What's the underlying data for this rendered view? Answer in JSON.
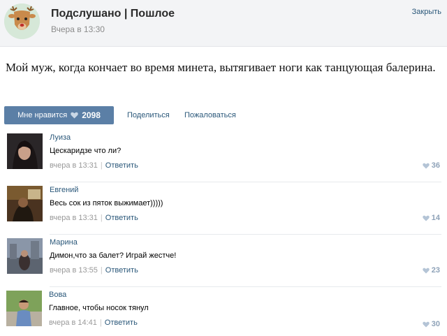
{
  "header": {
    "group_name": "Подслушано | Пошлое",
    "time": "Вчера в 13:30",
    "close_label": "Закрыть"
  },
  "post": {
    "text": "Мой муж, когда кончает во время минета, вытягивает ноги как танцующая балерина."
  },
  "actions": {
    "like_label": "Мне нравится",
    "like_count": "2098",
    "share_label": "Поделиться",
    "report_label": "Пожаловаться"
  },
  "comments": [
    {
      "author": "Луиза",
      "text": "Цескаридзе что ли?",
      "time": "вчера в 13:31",
      "reply": "Ответить",
      "likes": "36"
    },
    {
      "author": "Евгений",
      "text": "Весь сок из пяток выжимает)))))",
      "time": "вчера в 13:31",
      "reply": "Ответить",
      "likes": "14"
    },
    {
      "author": "Марина",
      "text": "Димон,что за балет? Играй жестче!",
      "time": "вчера в 13:55",
      "reply": "Ответить",
      "likes": "23"
    },
    {
      "author": "Вова",
      "text": "Главное, чтобы носок тянул",
      "time": "вчера в 14:41",
      "reply": "Ответить",
      "likes": "30"
    }
  ],
  "colors": {
    "link": "#2b587a",
    "like_button": "#5b7fa6",
    "header_bg": "#f3f4f6"
  }
}
